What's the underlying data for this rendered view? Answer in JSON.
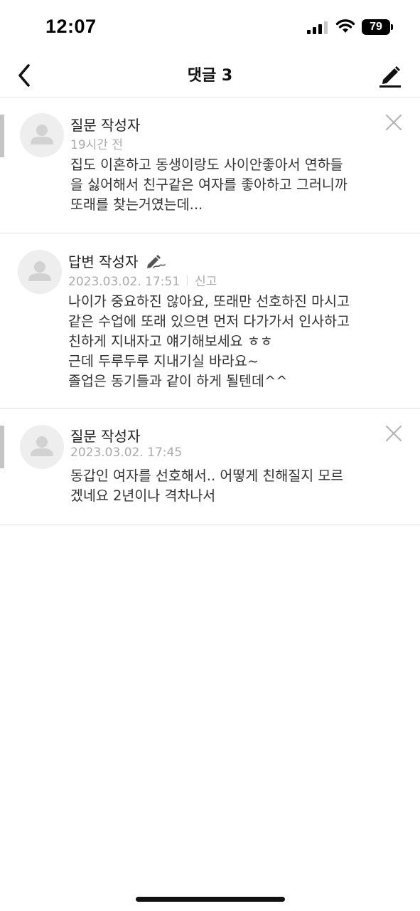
{
  "status_bar": {
    "time": "12:07",
    "battery": "79",
    "icons": [
      "cellular-signal-icon",
      "wifi-icon",
      "battery-icon"
    ]
  },
  "nav": {
    "title": "댓글 3",
    "back_icon": "chevron-left-icon",
    "write_icon": "pencil-edit-icon"
  },
  "comments": [
    {
      "author": "질문 작성자",
      "time": "19시간 전",
      "is_reply_indent": true,
      "has_delete": true,
      "lines": [
        "집도 이혼하고 동생이랑도 사이안좋아서 연하들",
        "을 싫어해서 친구같은 여자를 좋아하고 그러니까",
        "또래를 찾는거였는데..."
      ]
    },
    {
      "author": "답변 작성자",
      "time": "2023.03.02. 17:51",
      "report": "신고",
      "author_icon": "pencil-signature-icon",
      "lines": [
        "나이가 중요하진 않아요, 또래만 선호하진 마시고",
        "같은 수업에 또래 있으면 먼저 다가가서 인사하고",
        "친하게 지내자고 얘기해보세요 ㅎㅎ",
        "근데 두루두루 지내기실 바라요~",
        "졸업은 동기들과 같이 하게 될텐데^^"
      ]
    },
    {
      "author": "질문 작성자",
      "time": "2023.03.02. 17:45",
      "is_reply_indent": true,
      "has_delete": true,
      "lines": [
        "동갑인 여자를 선호해서.. 어떻게 친해질지 모르",
        "겠네요 2년이나 격차나서"
      ]
    }
  ],
  "colors": {
    "divider": "#e2e2e2",
    "meta_text": "#aaaaaa",
    "indent_bar": "#c4c4c4",
    "avatar_bg": "#eeeeee"
  }
}
